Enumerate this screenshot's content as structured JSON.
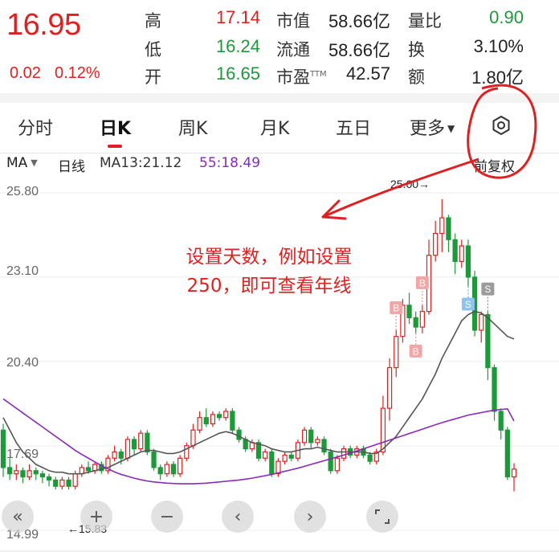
{
  "quote": {
    "price": "16.95",
    "change": "0.02",
    "change_pct": "0.12%",
    "stats": [
      {
        "label": "高",
        "value": "17.14"
      },
      {
        "label": "低",
        "value": "16.24"
      },
      {
        "label": "开",
        "value": "16.65"
      },
      {
        "label": "市值",
        "value": "58.66亿"
      },
      {
        "label": "流通",
        "value": "58.66亿"
      },
      {
        "label": "市盈",
        "sup": "TTM",
        "value": "42.57"
      },
      {
        "label": "量比",
        "value": "0.90"
      },
      {
        "label": "换",
        "value": "3.10%"
      },
      {
        "label": "额",
        "value": "1.80亿"
      }
    ]
  },
  "tabs": [
    "分时",
    "日K",
    "周K",
    "月K",
    "五日",
    "更多"
  ],
  "active_tab": "日K",
  "indicator_bar": {
    "ma_select": "MA",
    "period": "日线",
    "ma13": "MA13:21.12",
    "ma55": "55:18.49",
    "adjust": "前复权"
  },
  "chart": {
    "y_labels": [
      "25.80",
      "23.10",
      "20.40",
      "17.69",
      "14.99"
    ],
    "high_marker": "25.00→",
    "low_marker": "←15.83",
    "signals": [
      {
        "text": "B"
      },
      {
        "text": "B"
      },
      {
        "text": "B"
      },
      {
        "text": "S"
      },
      {
        "text": "S"
      }
    ]
  },
  "annotation": {
    "line1": "设置天数，例如设置",
    "line2": "250，即可查看年线"
  },
  "controls": {
    "collapse": "«",
    "zoom_in": "+",
    "zoom_out": "−",
    "prev": "‹",
    "next": "›"
  },
  "colors": {
    "up": "#e02020",
    "down": "#1c9a3a",
    "ma13": "#555555",
    "ma55": "#8a2bb5",
    "annotation": "#e02020"
  },
  "chart_data": {
    "type": "candlestick",
    "ylim": [
      14.99,
      25.8
    ],
    "up_color": "#e02020",
    "down_color": "#1c9a3a",
    "candles": [
      [
        18.2,
        17.0,
        18.4,
        16.7
      ],
      [
        17.0,
        16.8,
        17.3,
        16.6
      ],
      [
        16.8,
        16.9,
        17.1,
        16.6
      ],
      [
        16.9,
        16.7,
        17.0,
        16.5
      ],
      [
        16.7,
        16.9,
        17.1,
        16.6
      ],
      [
        16.9,
        16.8,
        17.0,
        16.6
      ],
      [
        16.8,
        16.7,
        16.9,
        16.5
      ],
      [
        16.7,
        16.6,
        16.8,
        16.4
      ],
      [
        16.6,
        16.4,
        16.7,
        16.3
      ],
      [
        16.4,
        16.6,
        16.7,
        16.3
      ],
      [
        16.6,
        16.4,
        16.7,
        16.3
      ],
      [
        16.4,
        16.8,
        16.9,
        16.3
      ],
      [
        16.8,
        17.0,
        17.1,
        16.7
      ],
      [
        17.0,
        16.9,
        17.2,
        16.8
      ],
      [
        16.9,
        17.1,
        17.2,
        16.8
      ],
      [
        17.1,
        16.9,
        17.2,
        16.8
      ],
      [
        16.9,
        17.3,
        17.4,
        16.8
      ],
      [
        17.3,
        17.5,
        17.7,
        17.2
      ],
      [
        17.5,
        17.3,
        17.6,
        17.1
      ],
      [
        17.3,
        17.9,
        18.0,
        17.2
      ],
      [
        17.9,
        17.6,
        18.0,
        17.4
      ],
      [
        17.6,
        18.1,
        18.2,
        17.5
      ],
      [
        18.1,
        17.5,
        18.2,
        17.4
      ],
      [
        17.5,
        17.0,
        17.6,
        16.9
      ],
      [
        17.0,
        16.8,
        17.1,
        16.6
      ],
      [
        16.8,
        17.1,
        17.2,
        16.7
      ],
      [
        17.1,
        16.8,
        17.2,
        16.7
      ],
      [
        16.8,
        17.3,
        17.4,
        16.7
      ],
      [
        17.3,
        17.7,
        17.8,
        17.2
      ],
      [
        17.7,
        18.2,
        18.4,
        17.6
      ],
      [
        18.2,
        18.6,
        18.8,
        18.1
      ],
      [
        18.6,
        18.4,
        18.9,
        18.3
      ],
      [
        18.4,
        18.7,
        18.8,
        18.3
      ],
      [
        18.7,
        18.6,
        18.8,
        18.5
      ],
      [
        18.6,
        18.8,
        18.9,
        18.5
      ],
      [
        18.8,
        18.2,
        18.9,
        18.1
      ],
      [
        18.2,
        17.9,
        18.3,
        17.8
      ],
      [
        17.9,
        17.6,
        18.0,
        17.5
      ],
      [
        17.6,
        17.8,
        17.9,
        17.5
      ],
      [
        17.8,
        17.3,
        17.9,
        17.2
      ],
      [
        17.3,
        17.5,
        17.6,
        17.2
      ],
      [
        17.5,
        16.8,
        17.6,
        16.7
      ],
      [
        16.8,
        17.2,
        17.3,
        16.7
      ],
      [
        17.2,
        17.4,
        17.5,
        17.1
      ],
      [
        17.4,
        17.3,
        17.5,
        17.2
      ],
      [
        17.3,
        17.8,
        17.9,
        17.2
      ],
      [
        17.8,
        18.2,
        18.3,
        17.7
      ],
      [
        18.2,
        17.8,
        18.3,
        17.6
      ],
      [
        17.8,
        17.9,
        18.0,
        17.7
      ],
      [
        17.9,
        17.5,
        18.0,
        17.4
      ],
      [
        17.5,
        16.9,
        17.6,
        16.8
      ],
      [
        16.9,
        17.3,
        17.4,
        16.8
      ],
      [
        17.3,
        17.6,
        17.7,
        17.2
      ],
      [
        17.6,
        17.4,
        17.7,
        17.3
      ],
      [
        17.4,
        17.6,
        17.7,
        17.3
      ],
      [
        17.6,
        17.4,
        17.7,
        17.3
      ],
      [
        17.4,
        17.2,
        17.5,
        17.1
      ],
      [
        17.2,
        17.5,
        17.6,
        17.1
      ],
      [
        17.5,
        18.9,
        19.3,
        17.4
      ],
      [
        18.9,
        20.2,
        20.5,
        18.5
      ],
      [
        20.2,
        21.2,
        21.4,
        19.9
      ],
      [
        21.2,
        22.2,
        22.4,
        21.0
      ],
      [
        22.2,
        21.8,
        22.6,
        21.6
      ],
      [
        21.8,
        21.5,
        22.0,
        21.3
      ],
      [
        21.5,
        22.0,
        22.2,
        21.3
      ],
      [
        22.0,
        23.8,
        24.3,
        21.9
      ],
      [
        23.8,
        24.5,
        24.9,
        23.6
      ],
      [
        24.5,
        25.0,
        25.6,
        23.9
      ],
      [
        25.0,
        24.3,
        25.1,
        23.9
      ],
      [
        24.3,
        23.6,
        24.5,
        23.2
      ],
      [
        23.6,
        24.1,
        24.3,
        23.4
      ],
      [
        24.1,
        23.1,
        24.3,
        22.8
      ],
      [
        23.1,
        21.4,
        23.3,
        21.2
      ],
      [
        21.4,
        21.9,
        22.0,
        21.0
      ],
      [
        21.9,
        20.2,
        22.0,
        19.8
      ],
      [
        20.2,
        18.8,
        20.3,
        18.5
      ],
      [
        18.8,
        18.2,
        18.9,
        17.9
      ],
      [
        18.2,
        16.7,
        18.3,
        16.6
      ],
      [
        16.7,
        16.95,
        17.14,
        16.24
      ]
    ],
    "high_label": "25.00",
    "low_label": "15.83",
    "series": [
      {
        "name": "MA13",
        "values": [
          18.6,
          18.2,
          17.8,
          17.5,
          17.3,
          17.1,
          17.0,
          16.9,
          16.85,
          16.85,
          16.8,
          16.8,
          16.8,
          16.85,
          16.9,
          16.95,
          17.0,
          17.1,
          17.2,
          17.3,
          17.4,
          17.5,
          17.55,
          17.55,
          17.5,
          17.45,
          17.45,
          17.5,
          17.6,
          17.7,
          17.8,
          17.9,
          18.0,
          18.1,
          18.15,
          18.1,
          18.0,
          17.9,
          17.8,
          17.75,
          17.7,
          17.6,
          17.55,
          17.5,
          17.5,
          17.55,
          17.6,
          17.6,
          17.65,
          17.6,
          17.55,
          17.5,
          17.5,
          17.5,
          17.5,
          17.5,
          17.45,
          17.45,
          17.6,
          17.8,
          18.0,
          18.3,
          18.6,
          18.9,
          19.2,
          19.6,
          20.0,
          20.5,
          20.9,
          21.3,
          21.7,
          21.9,
          22.0,
          21.95,
          21.8,
          21.6,
          21.4,
          21.2,
          21.12
        ]
      },
      {
        "name": "MA55",
        "values": [
          19.2,
          19.05,
          18.9,
          18.75,
          18.6,
          18.45,
          18.3,
          18.15,
          18.0,
          17.85,
          17.7,
          17.55,
          17.42,
          17.3,
          17.18,
          17.06,
          16.96,
          16.86,
          16.78,
          16.72,
          16.66,
          16.61,
          16.57,
          16.54,
          16.52,
          16.5,
          16.49,
          16.48,
          16.48,
          16.48,
          16.49,
          16.5,
          16.52,
          16.54,
          16.56,
          16.58,
          16.6,
          16.63,
          16.66,
          16.7,
          16.74,
          16.78,
          16.83,
          16.88,
          16.93,
          16.98,
          17.04,
          17.1,
          17.16,
          17.22,
          17.28,
          17.34,
          17.4,
          17.46,
          17.53,
          17.6,
          17.67,
          17.74,
          17.81,
          17.88,
          17.95,
          18.02,
          18.09,
          18.16,
          18.23,
          18.3,
          18.37,
          18.44,
          18.5,
          18.56,
          18.62,
          18.68,
          18.72,
          18.76,
          18.8,
          18.84,
          18.86,
          18.88,
          18.49
        ]
      }
    ],
    "signals": [
      {
        "index": 64,
        "type": "B",
        "at": "high"
      },
      {
        "index": 60,
        "type": "B",
        "at": "high"
      },
      {
        "index": 63,
        "type": "B",
        "at": "low"
      },
      {
        "index": 71,
        "type": "S",
        "at": "low"
      },
      {
        "index": 74,
        "type": "S",
        "at": "high"
      }
    ]
  }
}
